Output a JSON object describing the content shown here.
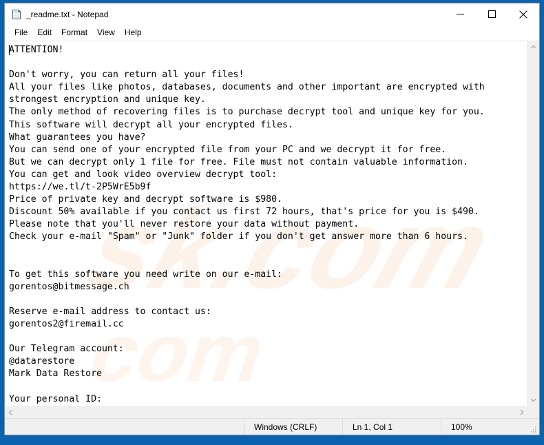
{
  "window": {
    "title": "_readme.txt - Notepad",
    "icon": "notepad-icon",
    "controls": {
      "minimize": "Minimize",
      "maximize": "Maximize",
      "close": "Close"
    }
  },
  "menubar": {
    "items": [
      {
        "label": "File"
      },
      {
        "label": "Edit"
      },
      {
        "label": "Format"
      },
      {
        "label": "View"
      },
      {
        "label": "Help"
      }
    ]
  },
  "editor": {
    "content": "ATTENTION!\n\nDon't worry, you can return all your files!\nAll your files like photos, databases, documents and other important are encrypted with\nstrongest encryption and unique key.\nThe only method of recovering files is to purchase decrypt tool and unique key for you.\nThis software will decrypt all your encrypted files.\nWhat guarantees you have?\nYou can send one of your encrypted file from your PC and we decrypt it for free.\nBut we can decrypt only 1 file for free. File must not contain valuable information.\nYou can get and look video overview decrypt tool:\nhttps://we.tl/t-2P5WrE5b9f\nPrice of private key and decrypt software is $980.\nDiscount 50% available if you contact us first 72 hours, that's price for you is $490.\nPlease note that you'll never restore your data without payment.\nCheck your e-mail \"Spam\" or \"Junk\" folder if you don't get answer more than 6 hours.\n\n\nTo get this software you need write on our e-mail:\ngorentos@bitmessage.ch\n\nReserve e-mail address to contact us:\ngorentos2@firemail.cc\n\nOur Telegram account:\n@datarestore\nMark Data Restore\n\nYour personal ID:\n-",
    "lines": [
      "ATTENTION!",
      "",
      "Don't worry, you can return all your files!",
      "All your files like photos, databases, documents and other important are encrypted with",
      "strongest encryption and unique key.",
      "The only method of recovering files is to purchase decrypt tool and unique key for you.",
      "This software will decrypt all your encrypted files.",
      "What guarantees you have?",
      "You can send one of your encrypted file from your PC and we decrypt it for free.",
      "But we can decrypt only 1 file for free. File must not contain valuable information.",
      "You can get and look video overview decrypt tool:",
      "https://we.tl/t-2P5WrE5b9f",
      "Price of private key and decrypt software is $980.",
      "Discount 50% available if you contact us first 72 hours, that's price for you is $490.",
      "Please note that you'll never restore your data without payment.",
      "Check your e-mail \"Spam\" or \"Junk\" folder if you don't get answer more than 6 hours.",
      "",
      "",
      "To get this software you need write on our e-mail:",
      "gorentos@bitmessage.ch",
      "",
      "Reserve e-mail address to contact us:",
      "gorentos2@firemail.cc",
      "",
      "Our Telegram account:",
      "@datarestore",
      "Mark Data Restore",
      "",
      "Your personal ID:",
      "-"
    ],
    "contacts": {
      "video_url": "https://we.tl/t-2P5WrE5b9f",
      "primary_email": "gorentos@bitmessage.ch",
      "reserve_email": "gorentos2@firemail.cc",
      "telegram": "@datarestore",
      "telegram_name": "Mark Data Restore",
      "personal_id": "-",
      "price": "$980",
      "discount_price": "$490",
      "discount_percent": "50%",
      "discount_window": "72 hours",
      "reply_window": "6 hours"
    }
  },
  "watermark": {
    "text": "pcrisk.com",
    "visible_text": "sk.com",
    "color": "#fdf2ea"
  },
  "statusbar": {
    "eol": "Windows (CRLF)",
    "cursor": "Ln 1, Col 1",
    "zoom": "100%"
  },
  "scrollbars": {
    "vertical_up": "▲",
    "vertical_down": "▼",
    "horizontal_left": "◀",
    "horizontal_right": "▶"
  },
  "colors": {
    "desktop": "#0b63ad",
    "window_bg": "#ffffff",
    "chrome": "#f0f0f0",
    "text": "#000000"
  }
}
